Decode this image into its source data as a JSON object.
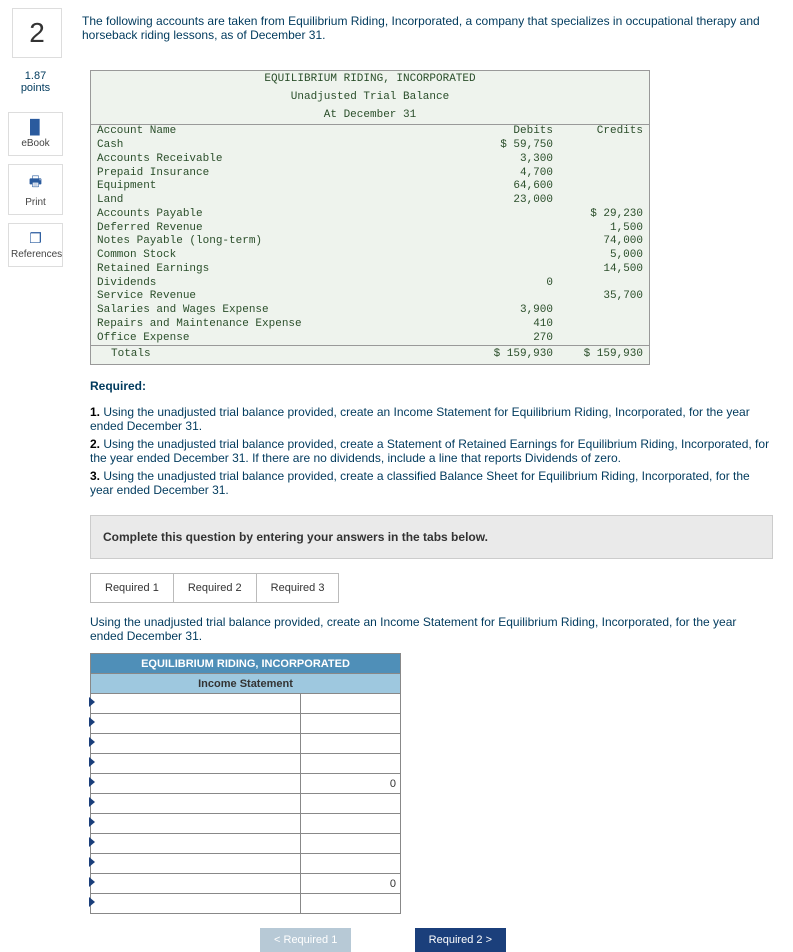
{
  "question_number": "2",
  "intro": "The following accounts are taken from Equilibrium Riding, Incorporated, a company that specializes in occupational therapy and horseback riding lessons, as of December 31.",
  "points": "1.87",
  "points_label": "points",
  "tools": {
    "ebook": "eBook",
    "print": "Print",
    "references": "References"
  },
  "trial_balance": {
    "title1": "EQUILIBRIUM RIDING, INCORPORATED",
    "title2": "Unadjusted Trial Balance",
    "title3": "At December 31",
    "col_account": "Account Name",
    "col_debits": "Debits",
    "col_credits": "Credits",
    "rows": [
      {
        "name": "Cash",
        "debit": "$ 59,750",
        "credit": ""
      },
      {
        "name": "Accounts Receivable",
        "debit": "3,300",
        "credit": ""
      },
      {
        "name": "Prepaid Insurance",
        "debit": "4,700",
        "credit": ""
      },
      {
        "name": "Equipment",
        "debit": "64,600",
        "credit": ""
      },
      {
        "name": "Land",
        "debit": "23,000",
        "credit": ""
      },
      {
        "name": "Accounts Payable",
        "debit": "",
        "credit": "$ 29,230"
      },
      {
        "name": "Deferred Revenue",
        "debit": "",
        "credit": "1,500"
      },
      {
        "name": "Notes Payable (long-term)",
        "debit": "",
        "credit": "74,000"
      },
      {
        "name": "Common Stock",
        "debit": "",
        "credit": "5,000"
      },
      {
        "name": "Retained Earnings",
        "debit": "",
        "credit": "14,500"
      },
      {
        "name": "Dividends",
        "debit": "0",
        "credit": ""
      },
      {
        "name": "Service Revenue",
        "debit": "",
        "credit": "35,700"
      },
      {
        "name": "Salaries and Wages Expense",
        "debit": "3,900",
        "credit": ""
      },
      {
        "name": "Repairs and Maintenance Expense",
        "debit": "410",
        "credit": ""
      },
      {
        "name": "Office Expense",
        "debit": "270",
        "credit": ""
      }
    ],
    "totals_label": "Totals",
    "totals_debit": "$ 159,930",
    "totals_credit": "$ 159,930"
  },
  "required_heading": "Required:",
  "required_items": [
    "Using the unadjusted trial balance provided, create an Income Statement for Equilibrium Riding, Incorporated, for the year ended December 31.",
    "Using the unadjusted trial balance provided, create a Statement of Retained Earnings for Equilibrium Riding, Incorporated, for the year ended December 31. If there are no dividends, include a line that reports Dividends of zero.",
    "Using the unadjusted trial balance provided, create a classified Balance Sheet for Equilibrium Riding, Incorporated, for the year ended December 31."
  ],
  "instruction_bar": "Complete this question by entering your answers in the tabs below.",
  "tabs": {
    "t1": "Required 1",
    "t2": "Required 2",
    "t3": "Required 3"
  },
  "tab1_instruction": "Using the unadjusted trial balance provided, create an Income Statement for Equilibrium Riding, Incorporated, for the year ended December 31.",
  "answer_header": "EQUILIBRIUM RIDING, INCORPORATED",
  "answer_subheader": "Income Statement",
  "zero": "0",
  "nav": {
    "prev": "Required 1",
    "next": "Required 2"
  }
}
